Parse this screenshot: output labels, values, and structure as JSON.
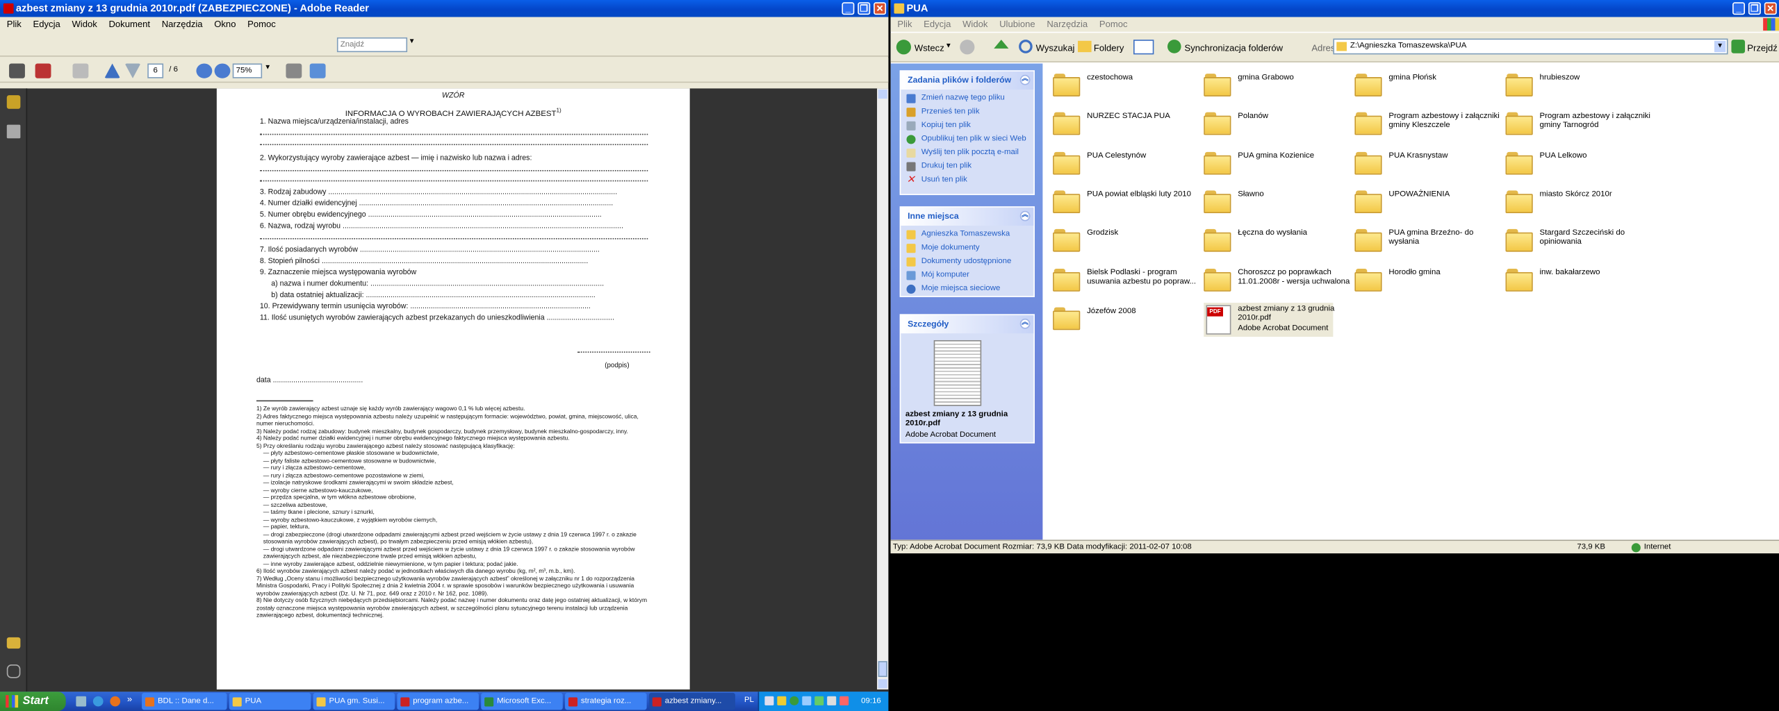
{
  "adobe": {
    "title": "azbest zmiany z 13 grudnia 2010r.pdf (ZABEZPIECZONE) - Adobe Reader",
    "menu": [
      "Plik",
      "Edycja",
      "Widok",
      "Dokument",
      "Narzędzia",
      "Okno",
      "Pomoc"
    ],
    "search_placeholder": "Znajdź",
    "page_current": "6",
    "page_total": "/ 6",
    "zoom": "75%",
    "doc": {
      "wzor": "WZÓR",
      "heading": "INFORMACJA O WYROBACH ZAWIERAJĄCYCH AZBEST",
      "heading_sup": "1)",
      "items": [
        "1. Nazwa miejsca/urządzenia/instalacji, adres",
        "2. Wykorzystujący wyroby zawierające azbest — imię i nazwisko lub nazwa i adres:",
        "3. Rodzaj zabudowy",
        "4. Numer działki ewidencyjnej",
        "5. Numer obrębu ewidencyjnego",
        "6. Nazwa, rodzaj wyrobu",
        "7. Ilość posiadanych wyrobów",
        "8. Stopień pilności",
        "9. Zaznaczenie miejsca występowania wyrobów",
        "a) nazwa i numer dokumentu:",
        "b) data ostatniej aktualizacji:",
        "10. Przewidywany termin usunięcia wyrobów:",
        "11. Ilość usuniętych wyrobów zawierających azbest przekazanych do unieszkodliwienia"
      ],
      "podpis": "(podpis)",
      "data": "data",
      "footnotes": [
        "1) Ze wyrób zawierający azbest uznaje się każdy wyrób zawierający wagowo 0,1 % lub więcej azbestu.",
        "2) Adres faktycznego miejsca występowania azbestu należy uzupełnić w następującym formacie: województwo, powiat, gmina, miejscowość, ulica, numer nieruchomości.",
        "3) Należy podać rodzaj zabudowy: budynek mieszkalny, budynek gospodarczy, budynek przemysłowy, budynek mieszkalno-gospodarczy, inny.",
        "4) Należy podać numer działki ewidencyjnej i numer obrębu ewidencyjnego faktycznego miejsca występowania azbestu.",
        "5) Przy określaniu rodzaju wyrobu zawierającego azbest należy stosować następującą klasyfikację:",
        "— płyty azbestowo-cementowe płaskie stosowane w budownictwie,",
        "— płyty faliste azbestowo-cementowe stosowane w budownictwie,",
        "— rury i złącza azbestowo-cementowe,",
        "— rury i złącza azbestowo-cementowe pozostawione w ziemi,",
        "— izolacje natryskowe środkami zawierającymi w swoim składzie azbest,",
        "— wyroby cierne azbestowo-kauczukowe,",
        "— przędza specjalna, w tym włókna azbestowe obrobione,",
        "— szczeliwa azbestowe,",
        "— taśmy tkane i plecione, sznury i sznurki,",
        "— wyroby azbestowo-kauczukowe, z wyjątkiem wyrobów ciernych,",
        "— papier, tektura,",
        "— drogi zabezpieczone (drogi utwardzone odpadami zawierającymi azbest przed wejściem w życie ustawy z dnia 19 czerwca 1997 r. o zakazie stosowania wyrobów zawierających azbest), po trwałym zabezpieczeniu przed emisją włókien azbestu),",
        "— drogi utwardzone odpadami zawierającymi azbest przed wejściem w życie ustawy z dnia 19 czerwca 1997 r. o zakazie stosowania wyrobów zawierających azbest, ale niezabezpieczone trwale przed emisją włókien azbestu,",
        "— inne wyroby zawierające azbest, oddzielnie niewymienione, w tym papier i tektura; podać jakie.",
        "6) Ilość wyrobów zawierających azbest należy podać w jednostkach właściwych dla danego wyrobu (kg, m², m³, m.b., km).",
        "7) Według „Oceny stanu i możliwości bezpiecznego użytkowania wyrobów zawierających azbest” określonej w załączniku nr 1 do rozporządzenia Ministra Gospodarki, Pracy i Polityki Społecznej z dnia 2 kwietnia 2004 r. w sprawie sposobów i warunków bezpiecznego użytkowania i usuwania wyrobów zawierających azbest (Dz. U. Nr 71, poz. 649 oraz z 2010 r. Nr 162, poz. 1089).",
        "8) Nie dotyczy osób fizycznych niebędących przedsiębiorcami. Należy podać nazwę i numer dokumentu oraz datę jego ostatniej aktualizacji, w którym zostały oznaczone miejsca występowania wyrobów zawierających azbest, w szczególności planu sytuacyjnego terenu instalacji lub urządzenia zawierającego azbest, dokumentacji technicznej."
      ]
    }
  },
  "explorer": {
    "title": "PUA",
    "menu": [
      "Plik",
      "Edycja",
      "Widok",
      "Ulubione",
      "Narzędzia",
      "Pomoc"
    ],
    "toolbar": {
      "back": "Wstecz",
      "search": "Wyszukaj",
      "folders": "Foldery",
      "sync": "Synchronizacja folderów",
      "address_label": "Adres",
      "address": "Z:\\Agnieszka Tomaszewska\\PUA",
      "go": "Przejdź"
    },
    "task_panel": {
      "title": "Zadania plików i folderów",
      "items": [
        "Zmień nazwę tego pliku",
        "Przenieś ten plik",
        "Kopiuj ten plik",
        "Opublikuj ten plik w sieci Web",
        "Wyślij ten plik pocztą e-mail",
        "Drukuj ten plik",
        "Usuń ten plik"
      ]
    },
    "other_places": {
      "title": "Inne miejsca",
      "items": [
        "Agnieszka Tomaszewska",
        "Moje dokumenty",
        "Dokumenty udostępnione",
        "Mój komputer",
        "Moje miejsca sieciowe"
      ]
    },
    "details": {
      "title": "Szczegóły",
      "name": "azbest zmiany z 13 grudnia 2010r.pdf",
      "type": "Adobe Acrobat Document"
    },
    "files": [
      "czestochowa",
      "gmina Grabowo",
      "gmina Płońsk",
      "hrubieszow",
      "NURZEC STACJA PUA",
      "Polanów",
      "Program azbestowy i załączniki gminy Kleszczele",
      "Program azbestowy i załączniki gminy Tarnogród",
      "PUA Celestynów",
      "PUA gmina Kozienice",
      "PUA Krasnystaw",
      "PUA Lelkowo",
      "PUA powiat elbląski luty 2010",
      "Sławno",
      "UPOWAŻNIENIA",
      "miasto Skórcz 2010r",
      "Grodzisk",
      "Łęczna do wysłania",
      "PUA gmina Brzeźno- do wysłania",
      "Stargard Szczeciński do opiniowania",
      "Bielsk Podlaski - program usuwania azbestu po popraw...",
      "Choroszcz po poprawkach 11.01.2008r - wersja uchwalona",
      "Horodło gmina",
      "inw. bakałarzewo",
      "Józefów 2008"
    ],
    "pdf_file": {
      "name": "azbest zmiany z 13 grudnia 2010r.pdf",
      "type": "Adobe Acrobat Document",
      "badge": "PDF"
    },
    "status": {
      "left": "Typ: Adobe Acrobat Document Rozmiar: 73,9 KB Data modyfikacji: 2011-02-07 10:08",
      "size": "73,9 KB",
      "zone": "Internet"
    }
  },
  "taskbar": {
    "start": "Start",
    "tasks": [
      "BDL :: Dane d...",
      "PUA",
      "PUA gm. Susi...",
      "program azbe...",
      "Microsoft Exc...",
      "strategia roz...",
      "azbest zmiany..."
    ],
    "lang": "PL",
    "time": "09:16"
  },
  "colors": {
    "xp_blue": "#0a5fe8",
    "task_panel": "#6375d6",
    "link": "#215dc6",
    "folder": "#f3c847",
    "start_green": "#3c9d3c"
  }
}
